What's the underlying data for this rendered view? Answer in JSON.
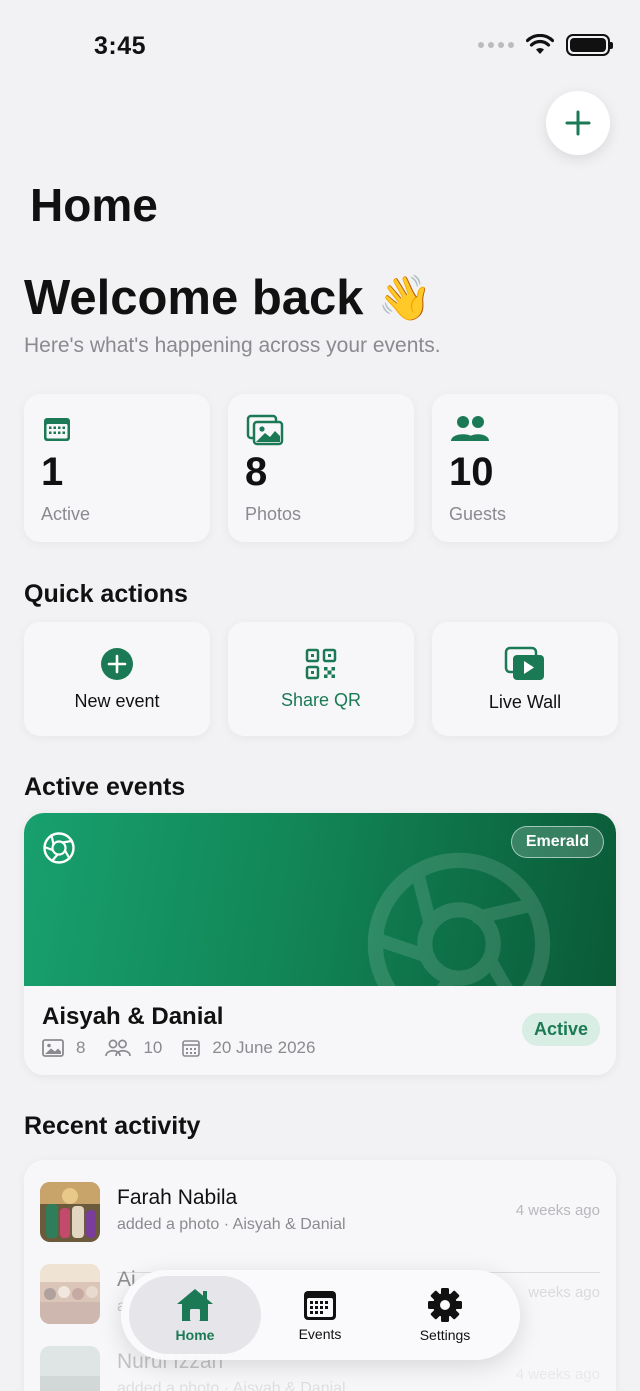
{
  "status_bar": {
    "time": "3:45"
  },
  "header": {
    "title": "Home"
  },
  "welcome": {
    "title": "Welcome back",
    "emoji": "👋",
    "subtitle": "Here's what's happening across your events."
  },
  "stats": [
    {
      "value": "1",
      "label": "Active",
      "icon": "calendar-icon"
    },
    {
      "value": "8",
      "label": "Photos",
      "icon": "photos-icon"
    },
    {
      "value": "10",
      "label": "Guests",
      "icon": "guests-icon"
    }
  ],
  "quick_actions": {
    "title": "Quick actions",
    "items": [
      {
        "label": "New event",
        "icon": "plus-circle-icon"
      },
      {
        "label": "Share QR",
        "icon": "qr-code-icon"
      },
      {
        "label": "Live Wall",
        "icon": "live-wall-icon"
      }
    ]
  },
  "active_events": {
    "title": "Active events",
    "event": {
      "name": "Aisyah & Danial",
      "tier": "Emerald",
      "status": "Active",
      "photos": "8",
      "guests": "10",
      "date": "20 June 2026"
    }
  },
  "recent_activity": {
    "title": "Recent activity",
    "items": [
      {
        "name": "Farah Nabila",
        "desc": "added a photo · Aisyah & Danial",
        "time": "4 weeks ago"
      },
      {
        "name": "Ai",
        "desc": "a",
        "time": "weeks ago"
      },
      {
        "name": "Nurul Izzan",
        "desc": "added a photo · Aisyah & Danial",
        "time": "4 weeks ago"
      }
    ]
  },
  "tab_bar": {
    "items": [
      {
        "label": "Home",
        "active": true
      },
      {
        "label": "Events",
        "active": false
      },
      {
        "label": "Settings",
        "active": false
      }
    ]
  },
  "colors": {
    "accent": "#1b7a55",
    "banner_start": "#18a06f",
    "banner_end": "#0a5a37"
  }
}
